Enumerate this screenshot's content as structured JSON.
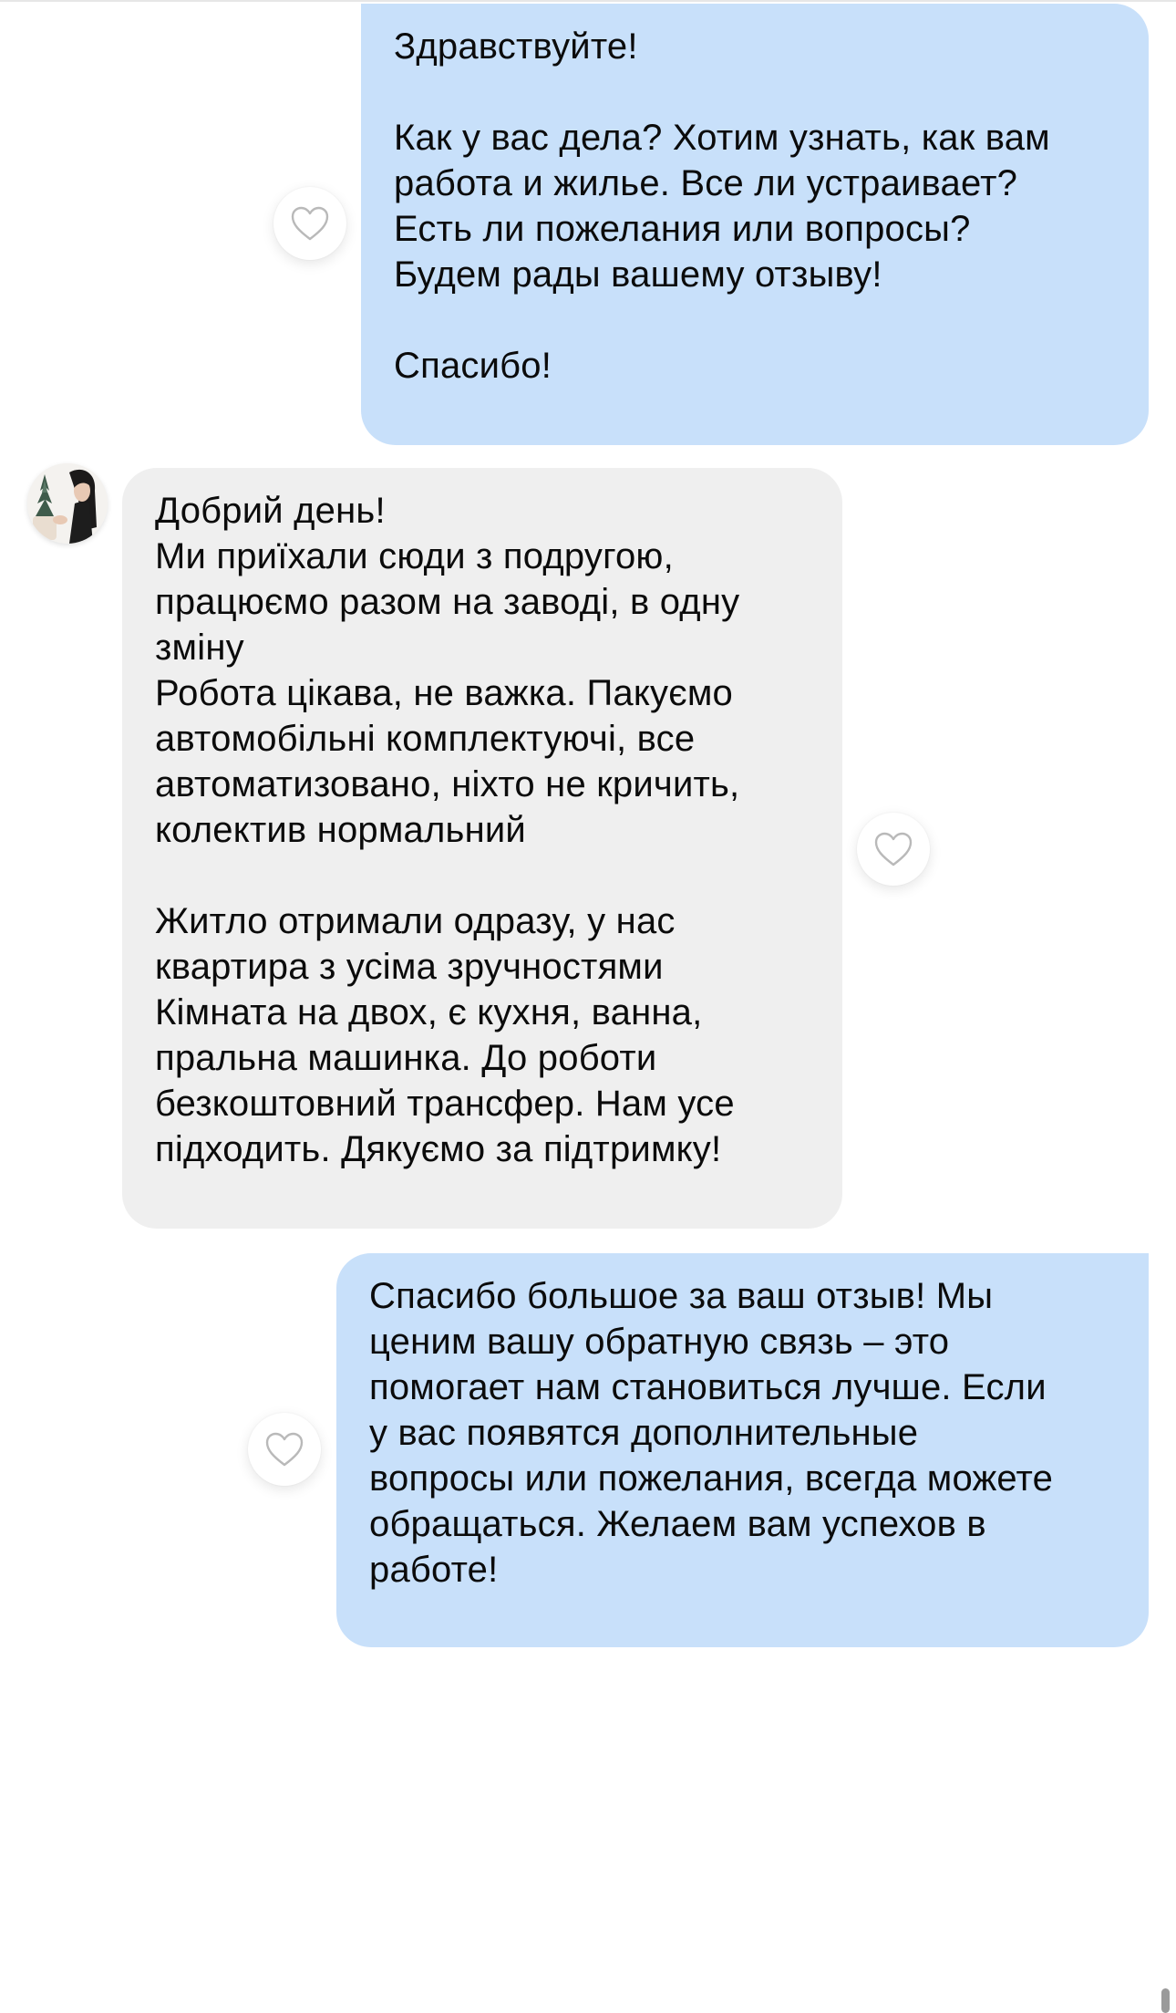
{
  "messages": [
    {
      "direction": "outgoing",
      "text": "Здравствуйте!\n\nКак у вас дела? Хотим узнать, как вам\nработа и жилье. Все ли устраивает?\nЕсть ли пожелания или вопросы?\nБудем рады вашему отзыву!\n\nСпасибо!"
    },
    {
      "direction": "incoming",
      "text": "Добрий день!\nМи приїхали сюди з подругою,\nпрацюємо разом на заводі, в одну\nзміну\nРобота цікава, не важка. Пакуємо\nавтомобільні комплектуючі, все\nавтоматизовано, ніхто не кричить,\nколектив нормальний\n\nЖитло отримали одразу, у нас\nквартира з усіма зручностями\nКімната на двох, є кухня, ванна,\nпральна машинка. До роботи\nбезкоштовний трансфер. Нам усе\nпідходить. Дякуємо за підтримку!"
    },
    {
      "direction": "outgoing",
      "text": "Спасибо большое за ваш отзыв! Мы\nценим вашу обратную связь – это\nпомогает нам становиться лучше. Если\nу вас появятся дополнительные\nвопросы или пожелания, всегда можете\nобращаться. Желаем вам успехов в\nработе!"
    }
  ],
  "icons": {
    "reaction": "heart-outline-icon",
    "sender_avatar": "avatar"
  },
  "colors": {
    "outgoing_bubble": "#c8e0fa",
    "incoming_bubble": "#efefef",
    "background": "#ffffff",
    "heart_stroke": "#b9b9b9"
  }
}
